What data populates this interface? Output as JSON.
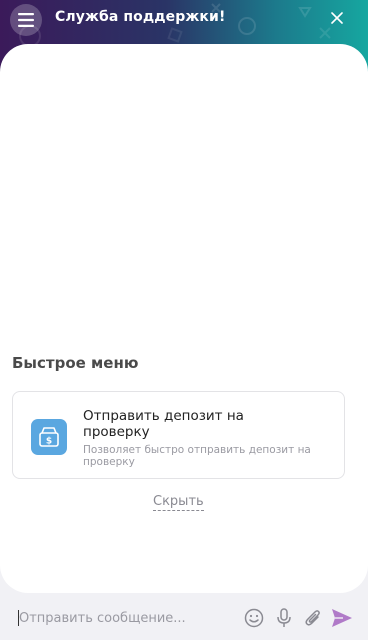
{
  "header": {
    "title": "Служба поддержки!",
    "menu_icon": "hamburger-icon",
    "close_icon": "close-icon"
  },
  "quick_menu": {
    "title": "Быстрое меню",
    "items": [
      {
        "title": "Отправить депозит на проверку",
        "description": "Позволяет быстро отправить депозит на проверку",
        "icon": "money-box-icon"
      }
    ],
    "hide_label": "Скрыть"
  },
  "composer": {
    "placeholder": "Отправить сообщение...",
    "icons": [
      "emoji-icon",
      "microphone-icon",
      "paperclip-icon",
      "send-icon"
    ]
  },
  "colors": {
    "header_gradient_start": "#3b1a5a",
    "header_gradient_end": "#16a7a0",
    "icon_tile": "#5aa7e0",
    "send": "#b07ac8"
  }
}
